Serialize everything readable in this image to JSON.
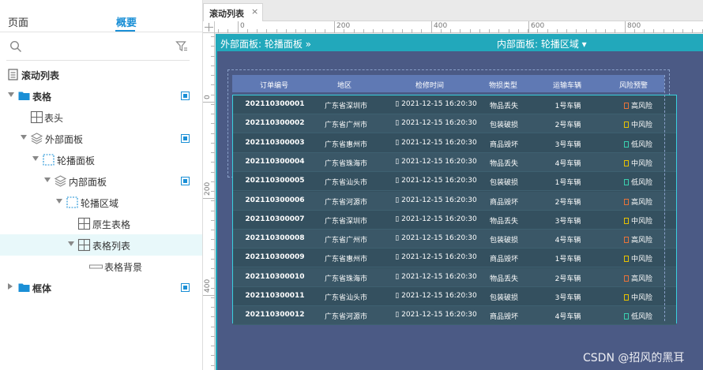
{
  "left_panel": {
    "tabs": {
      "page": "页面",
      "overview": "概要"
    },
    "tree": [
      {
        "label": "滚动列表",
        "icon": "page-icon",
        "bold": true
      },
      {
        "label": "表格",
        "icon": "folder-icon",
        "bold": true
      },
      {
        "label": "表头",
        "icon": "table-icon",
        "bold": false
      },
      {
        "label": "外部面板",
        "icon": "layers-icon",
        "bold": false
      },
      {
        "label": "轮播面板",
        "icon": "dashed-box-icon",
        "bold": false
      },
      {
        "label": "内部面板",
        "icon": "layers-icon",
        "bold": false
      },
      {
        "label": "轮播区域",
        "icon": "dashed-box-icon",
        "bold": false
      },
      {
        "label": "原生表格",
        "icon": "table-icon",
        "bold": false
      },
      {
        "label": "表格列表",
        "icon": "table-icon",
        "bold": false
      },
      {
        "label": "表格背景",
        "icon": "rectangle-icon",
        "bold": false
      },
      {
        "label": "框体",
        "icon": "folder-icon",
        "bold": true
      }
    ]
  },
  "canvas": {
    "tab_title": "滚动列表",
    "tab_close": "×",
    "ruler_h": [
      "0",
      "200",
      "400",
      "600",
      "800"
    ],
    "ruler_v": [
      "0",
      "200",
      "400"
    ],
    "outer_panel_label": "外部面板: 轮播面板 »",
    "inner_panel_label": "内部面板: 轮播区域 ▾"
  },
  "table": {
    "headers": [
      "订单编号",
      "地区",
      "检修时间",
      "物损类型",
      "运输车辆",
      "风险预警"
    ],
    "rows": [
      [
        "202110300001",
        "广东省深圳市",
        "▯ 2021-12-15 16:20:30",
        "物品丢失",
        "1号车辆",
        "高风险"
      ],
      [
        "202110300002",
        "广东省广州市",
        "▯ 2021-12-15 16:20:30",
        "包装破损",
        "2号车辆",
        "中风险"
      ],
      [
        "202110300003",
        "广东省惠州市",
        "▯ 2021-12-15 16:20:30",
        "商品毁坏",
        "3号车辆",
        "低风险"
      ],
      [
        "202110300004",
        "广东省珠海市",
        "▯ 2021-12-15 16:20:30",
        "物品丢失",
        "4号车辆",
        "中风险"
      ],
      [
        "202110300005",
        "广东省汕头市",
        "▯ 2021-12-15 16:20:30",
        "包装破损",
        "1号车辆",
        "低风险"
      ],
      [
        "202110300006",
        "广东省河源市",
        "▯ 2021-12-15 16:20:30",
        "商品毁坏",
        "2号车辆",
        "高风险"
      ],
      [
        "202110300007",
        "广东省深圳市",
        "▯ 2021-12-15 16:20:30",
        "物品丢失",
        "3号车辆",
        "中风险"
      ],
      [
        "202110300008",
        "广东省广州市",
        "▯ 2021-12-15 16:20:30",
        "包装破损",
        "4号车辆",
        "高风险"
      ],
      [
        "202110300009",
        "广东省惠州市",
        "▯ 2021-12-15 16:20:30",
        "商品毁坏",
        "1号车辆",
        "中风险"
      ],
      [
        "202110300010",
        "广东省珠海市",
        "▯ 2021-12-15 16:20:30",
        "物品丢失",
        "2号车辆",
        "高风险"
      ],
      [
        "202110300011",
        "广东省汕头市",
        "▯ 2021-12-15 16:20:30",
        "包装破损",
        "3号车辆",
        "中风险"
      ],
      [
        "202110300012",
        "广东省河源市",
        "▯ 2021-12-15 16:20:30",
        "商品毁坏",
        "4号车辆",
        "低风险"
      ]
    ],
    "risk_colors": {
      "高风险": "#e8733a",
      "中风险": "#e8c200",
      "低风险": "#3ad0b0"
    }
  },
  "watermark": "CSDN @招风的黑耳",
  "colors": {
    "accent": "#1a8fd6",
    "frame": "#22a8bb",
    "canvas_bg": "#4b5a85",
    "header_bg": "#5f79b4"
  }
}
